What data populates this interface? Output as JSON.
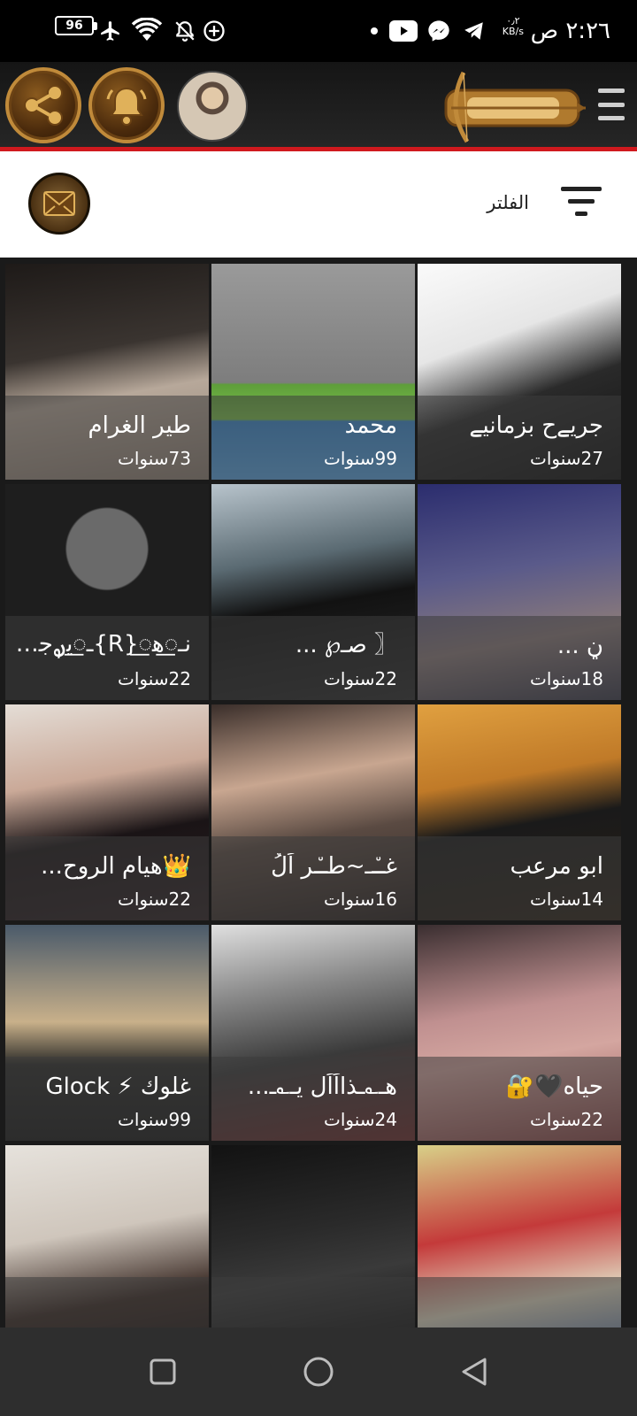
{
  "status_bar": {
    "time": "٢:٢٦ ص",
    "speed_value": "٠٫٢",
    "speed_unit": "KB/s",
    "battery": "96"
  },
  "filter": {
    "label": "الفلتر"
  },
  "profiles": [
    {
      "name": "جريےح بزمانيے",
      "age": "27سنوات"
    },
    {
      "name": "محمد",
      "age": "99سنوات"
    },
    {
      "name": "طير الغرام",
      "age": "73سنوات"
    },
    {
      "name": "ڼ ...",
      "age": "18سنوات"
    },
    {
      "name": "〖 ﺻـ℘ ...",
      "age": "22سنوات"
    },
    {
      "name": "ﻧـ꯭ﮬ꯭{R}ـ꯭ﯾࢪجـ ...",
      "age": "22سنوات"
    },
    {
      "name": "ابو مرعب",
      "age": "14سنوات"
    },
    {
      "name": "غـ٘ـ~طـ٘ر اَلُ",
      "age": "16سنوات"
    },
    {
      "name": "👑هيام الروح...",
      "age": "22سنوات"
    },
    {
      "name": "حياه🖤🔐",
      "age": "22سنوات"
    },
    {
      "name": "هـ؎ـذااَاَل يـ؎ـ...",
      "age": "24سنوات"
    },
    {
      "name": "غلوك ⚡ Glock",
      "age": "99سنوات"
    },
    {
      "name": "",
      "age": ""
    },
    {
      "name": "",
      "age": ""
    },
    {
      "name": "",
      "age": ""
    }
  ],
  "colors": {
    "accent_red": "#d0191e",
    "gold": "#c08a3a",
    "header_bg": "#1a1a1a"
  }
}
